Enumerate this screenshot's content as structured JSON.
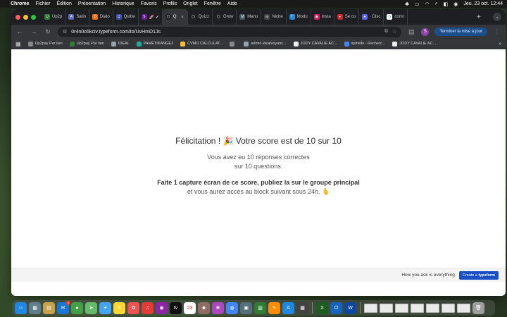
{
  "menubar": {
    "app": "Chrome",
    "items": [
      "Fichier",
      "Édition",
      "Présentation",
      "Historique",
      "Favoris",
      "Profils",
      "Onglet",
      "Fenêtre",
      "Aide"
    ],
    "clock": "Jeu. 23 oct.  12:44"
  },
  "tabs": [
    {
      "label": "Up2p",
      "color": "#2e7d32",
      "glyph": "U"
    },
    {
      "label": "Satin",
      "color": "#5c6bc0",
      "glyph": "A"
    },
    {
      "label": "Dialo",
      "color": "#ef6c00",
      "glyph": "D"
    },
    {
      "label": "Quitte",
      "color": "#3949ab",
      "glyph": "Q"
    },
    {
      "label": "🚀 ✔",
      "color": "#6a1b9a",
      "glyph": "S"
    },
    {
      "label": "Q",
      "color": "#222222",
      "glyph": "▢",
      "active": true
    },
    {
      "label": "Quizz",
      "color": "#222222",
      "glyph": "▢"
    },
    {
      "label": "Grow",
      "color": "#222222",
      "glyph": "▢"
    },
    {
      "label": "Manu",
      "color": "#455a64",
      "glyph": "M"
    },
    {
      "label": "Niche",
      "color": "#424242",
      "glyph": "◎"
    },
    {
      "label": "Modu",
      "color": "#1e88e5",
      "glyph": "T"
    },
    {
      "label": "Insta",
      "color": "#d81b60",
      "glyph": "◉"
    },
    {
      "label": "Se co",
      "color": "#c62828",
      "glyph": "♦"
    },
    {
      "label": "· Disc",
      "color": "#5865f2",
      "glyph": "●"
    },
    {
      "label": "comr",
      "color": "#ffffff",
      "glyph": "G"
    }
  ],
  "toolbar": {
    "url": "0r4n0o5kciv.typeform.com/to/UvHmD1Js",
    "profile_initial": "S",
    "update_label": "Terminer la mise à jour"
  },
  "bookmarks": [
    {
      "label": "Up2pay Par lien",
      "color": "#888"
    },
    {
      "label": "Up2pay Par lien",
      "color": "#2e7d32"
    },
    {
      "label": "IDEAL",
      "color": "#90a4ae"
    },
    {
      "label": "PAMETIKANGE2",
      "color": "#26a69a"
    },
    {
      "label": "CVMO CALCULAT...",
      "color": "#fbc02d"
    },
    {
      "label": "",
      "color": "#888"
    },
    {
      "label": "admin.idealvoyanc...",
      "color": "#90a4ae"
    },
    {
      "label": "JODY CAVALIE AC...",
      "color": "#eeeeee"
    },
    {
      "label": "spinelle - Recherc...",
      "color": "#4285f4"
    },
    {
      "label": "JODY CAVALIE AC...",
      "color": "#eeeeee"
    }
  ],
  "main": {
    "title": "Félicitation ! 🎉 Votre score est de 10 sur 10",
    "line1": "Vous avez eu 10 réponses correctes",
    "line2": "sur 10 questions.",
    "bold_line": "Faite 1 capture écran de ce score, publiez la sur le groupe principal",
    "line3": "et vous aurez accès au block suivant sous 24h. 🫰"
  },
  "footer": {
    "ask": "How you ask is everything",
    "cta_prefix": "Create a",
    "cta_brand": "typeform"
  },
  "dock": {
    "apps": [
      {
        "name": "finder",
        "color": "#1e88e5",
        "glyph": "☺"
      },
      {
        "name": "launchpad",
        "color": "#607d8b",
        "glyph": "▦"
      },
      {
        "name": "notes-yellow",
        "color": "#c8a24a",
        "glyph": "▤"
      },
      {
        "name": "mail",
        "color": "#1976d2",
        "glyph": "✉",
        "badge": "1"
      },
      {
        "name": "messages",
        "color": "#43a047",
        "glyph": "●"
      },
      {
        "name": "maps",
        "color": "#66bb6a",
        "glyph": "➤"
      },
      {
        "name": "safari",
        "color": "#42a5f5",
        "glyph": "✦"
      },
      {
        "name": "notes",
        "color": "#fdd835",
        "glyph": "≡"
      },
      {
        "name": "photos",
        "color": "#ef5350",
        "glyph": "✿"
      },
      {
        "name": "music",
        "color": "#e53935",
        "glyph": "♫"
      },
      {
        "name": "podcasts",
        "color": "#8e24aa",
        "glyph": "◉"
      },
      {
        "name": "tv",
        "color": "#111111",
        "glyph": "tv"
      },
      {
        "name": "calendar",
        "color": "#ffffff",
        "glyph": "23"
      },
      {
        "name": "contacts",
        "color": "#8d6e63",
        "glyph": "☻"
      },
      {
        "name": "photos-color",
        "color": "#ab47bc",
        "glyph": "❀"
      },
      {
        "name": "chrome",
        "color": "#4285f4",
        "glyph": "◍"
      },
      {
        "name": "preview",
        "color": "#546e7a",
        "glyph": "▣"
      },
      {
        "name": "numbers",
        "color": "#2e7d32",
        "glyph": "▥"
      },
      {
        "name": "pages",
        "color": "#fb8c00",
        "glyph": "✎"
      },
      {
        "name": "appstore",
        "color": "#1e88e5",
        "glyph": "A"
      },
      {
        "name": "calculator",
        "color": "#424242",
        "glyph": "▦"
      },
      {
        "name": "excel",
        "color": "#1b5e20",
        "glyph": "X"
      },
      {
        "name": "outlook",
        "color": "#1565c0",
        "glyph": "O"
      },
      {
        "name": "word",
        "color": "#0d47a1",
        "glyph": "W"
      }
    ],
    "thumbs": 7
  }
}
